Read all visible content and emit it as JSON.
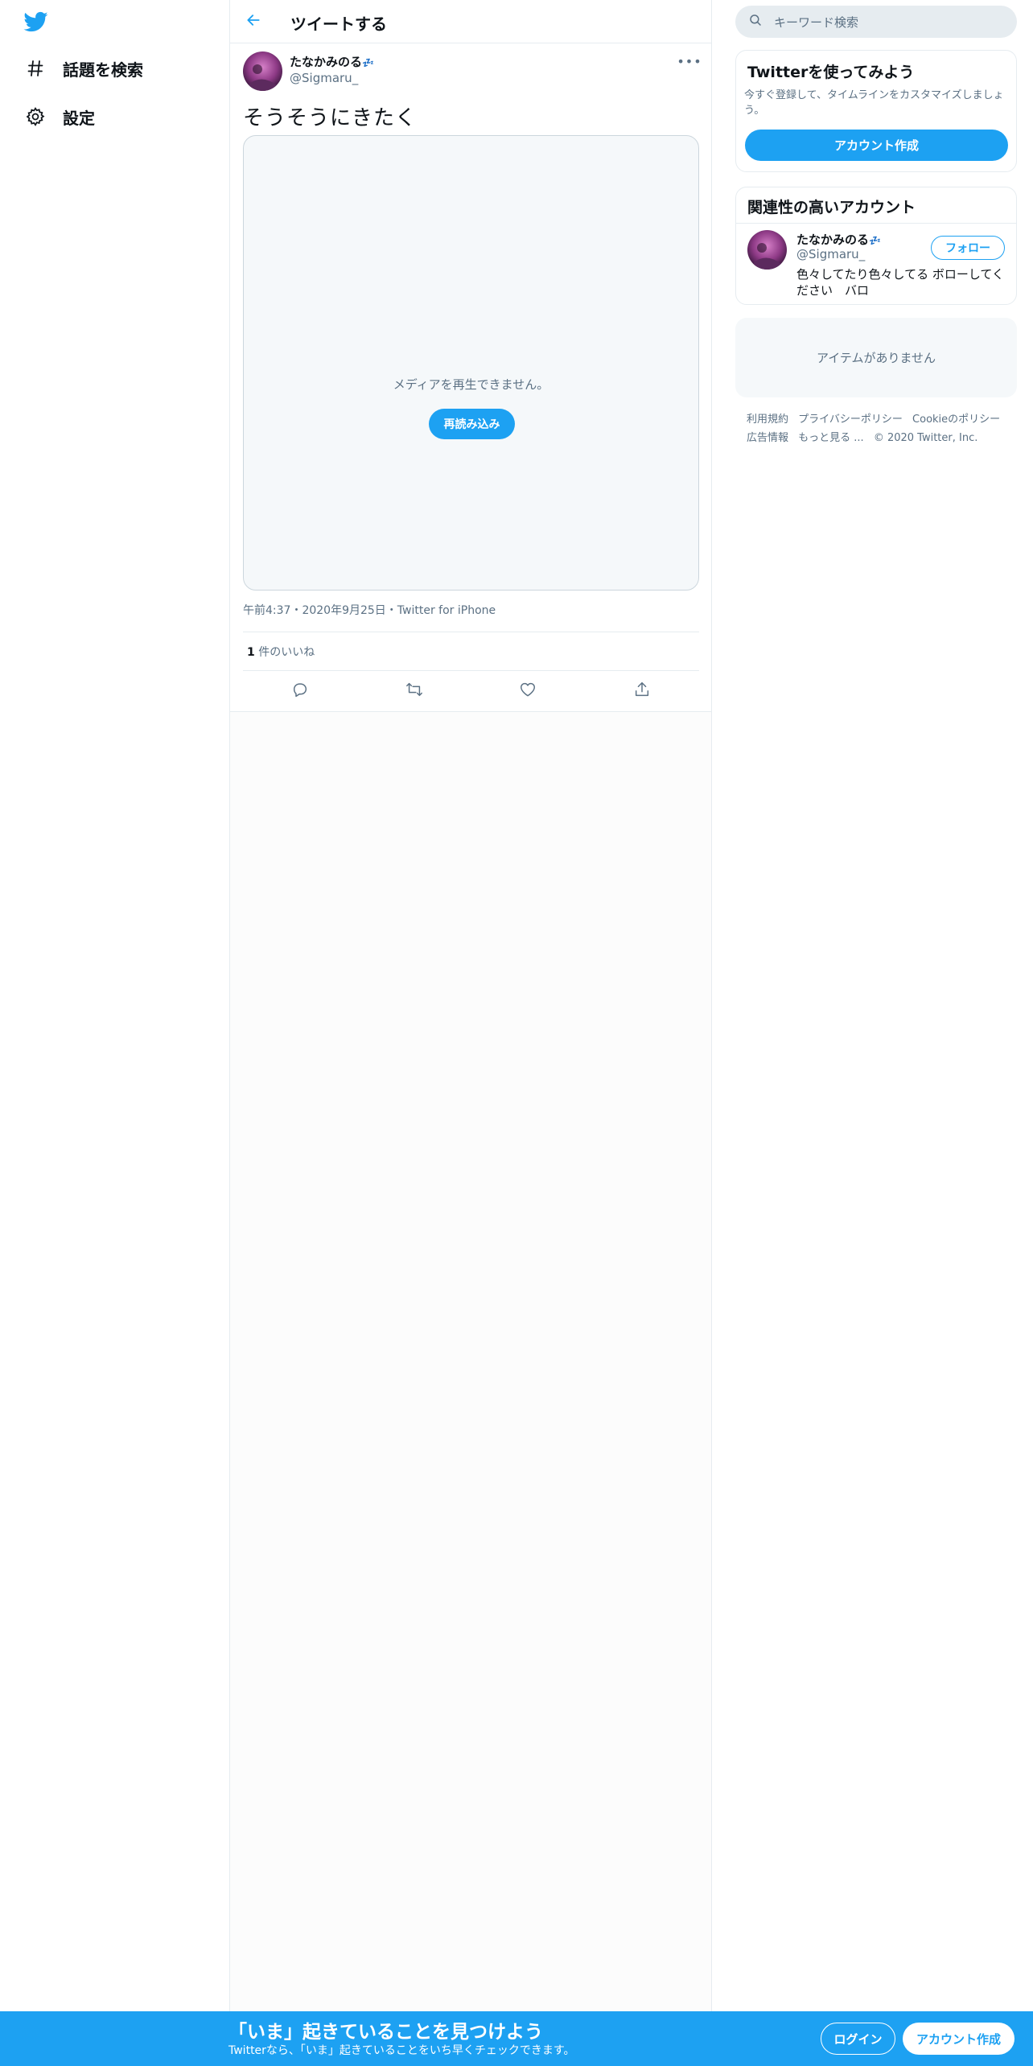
{
  "nav": {
    "logo_icon": "twitter-bird-icon",
    "items": [
      {
        "label": "話題を検索",
        "icon": "hashtag-icon"
      },
      {
        "label": "設定",
        "icon": "gear-icon"
      }
    ]
  },
  "header": {
    "title": "ツイートする",
    "back_icon": "arrow-left-icon"
  },
  "tweet": {
    "name": "たなかみのる",
    "name_emoji": "💤",
    "handle": "@Sigmaru_",
    "text": "そうそうにきたく",
    "media_message": "メディアを再生できません。",
    "reload_label": "再読み込み",
    "meta": "午前4:37・2020年9月25日・Twitter for iPhone",
    "likes_count": "1",
    "likes_label": " 件のいいね",
    "more_icon": "more-dots-icon",
    "actions": [
      "reply-icon",
      "retweet-icon",
      "like-icon",
      "share-icon"
    ]
  },
  "search": {
    "placeholder": "キーワード検索",
    "icon": "search-icon"
  },
  "signup_card": {
    "title": "Twitterを使ってみよう",
    "description": "今すぐ登録して、タイムラインをカスタマイズしましょう。",
    "button": "アカウント作成"
  },
  "related": {
    "title": "関連性の高いアカウント",
    "name": "たなかみのる",
    "name_emoji": "💤",
    "handle": "@Sigmaru_",
    "bio": "色々してたり色々してる ボローしてください　バロ",
    "follow": "フォロー"
  },
  "empty_card": {
    "text": "アイテムがありません"
  },
  "footer": {
    "links": [
      "利用規約",
      "プライバシーポリシー",
      "Cookieのポリシー",
      "広告情報",
      "もっと見る ..."
    ],
    "copyright": "© 2020 Twitter, Inc."
  },
  "bottom_bar": {
    "title": "「いま」起きていることを見つけよう",
    "subtitle": "Twitterなら、「いま」起きていることをいち早くチェックできます。",
    "login": "ログイン",
    "signup": "アカウント作成"
  },
  "colors": {
    "accent": "#1da1f2",
    "text": "#0f1419",
    "muted": "#5b7083",
    "border": "#e6ecf0"
  }
}
